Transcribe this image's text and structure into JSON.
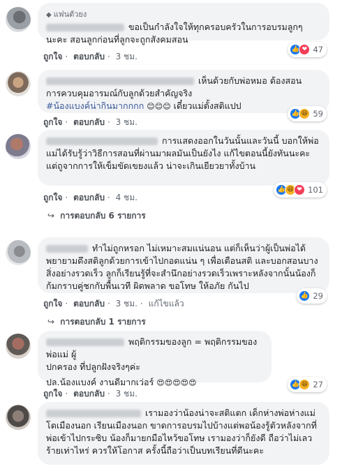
{
  "action_labels": {
    "like": "ถูกใจ",
    "reply": "ตอบกลับ",
    "edited": "แก้ไขแล้ว"
  },
  "comments": [
    {
      "badge": "แฟนตัวยง",
      "text": "ขอเป็นกำลังใจให้ทุกครอบครัวในการอบรมลูกๆ นะคะ สอนลูกก่อนที่ลูกจะถูกสังคมสอน",
      "time": "3 ชม.",
      "reaction_count": "47",
      "reaction_types": [
        "like-icon",
        "love-icon"
      ]
    },
    {
      "text_line1": "เห็นด้วยกับพ่อหมอ ต้องสอน",
      "text_line2": "การควบคุมอารมณ์กับลูกด้วยสำคัญจริง",
      "hashtag": "#น้องแบงค์น่ากินมากกกก",
      "emoji": "😊😊😊",
      "text_tail": "เดี๋ยวแม่ตั้งสติแปป",
      "time": "3 ชม.",
      "reaction_count": "59",
      "reaction_types": [
        "like-icon",
        "haha-icon"
      ]
    },
    {
      "text": "การแสดงออกในวันนั้นและวันนี้ บอกให้พ่อแม่ได้รับรู้ว่าวิธีการสอนที่ผ่านมาผลมันเป็นยังไง แก้ไขตอนนี้ยังทันนะคะ แต่ถูจากการให้เข็มขัดเขยงแล้ว น่าจะเกินเยียวยาทั้งบ้าน",
      "time": "4 ชม.",
      "reaction_count": "101",
      "reaction_types": [
        "like-icon",
        "haha-icon",
        "love-icon"
      ],
      "replies": "การตอบกลับ 6 รายการ"
    },
    {
      "text": "ทำไม่ถูกหรอก ไม่เหมาะสมแน่นอน แต่ก็เห็นว่าผู้เป็นพ่อได้พยายามดึงสติลูกด้วยการเข้าไปกอดแน่น ๆ เพื่อเตือนสติ และบอกสอนบางสิ่งอย่างรวดเร็ว ลูกก็เรียนรู้ที่จะสำนึกอย่างรวดเร็วเพราะหลังจากนั้นน้องก็ก้มกราบคู่ชกกับพื้นเวที ผิดพลาด ขอโทษ ให้อภัย กันไป",
      "time": "3 ชม.",
      "reaction_count": "29",
      "reaction_types": [
        "like-icon"
      ],
      "replies": "การตอบกลับ 1 รายการ"
    },
    {
      "text_line1": "พฤติกรรมของลูก = พฤติกรรมของพ่อแม่ ผู้",
      "text_line2": "ปกครอง ที่ปลูกฝังจริงๆค่ะ",
      "text_line3": "ปล.น้องแบงค์ งานดีมากเว่อร์",
      "emoji": "😍😍😍😍😍",
      "time": "3 ชม.",
      "reaction_count": "27",
      "reaction_types": [
        "like-icon",
        "haha-icon"
      ]
    },
    {
      "text": "เรามองว่าน้องน่าจะสติแตก เด็กห่างพ่อห่างแม่ โตเมืองนอก เรียนเมืองนอก ขาดการอบรมไปบ้างแต่พอน้องรู้ตัวหลังจากที่พ่อเข้าไปกระซิบ น้องก็มายกมือไหว้ขอโทษ เรามองว่าก็ยังดี ถือว่าไม่เลวร้ายเท่าไหร่ ควรให้โอกาส ครั้งนี้ถือว่าเป็นบทเรียนที่ดีนะคะ"
    }
  ]
}
